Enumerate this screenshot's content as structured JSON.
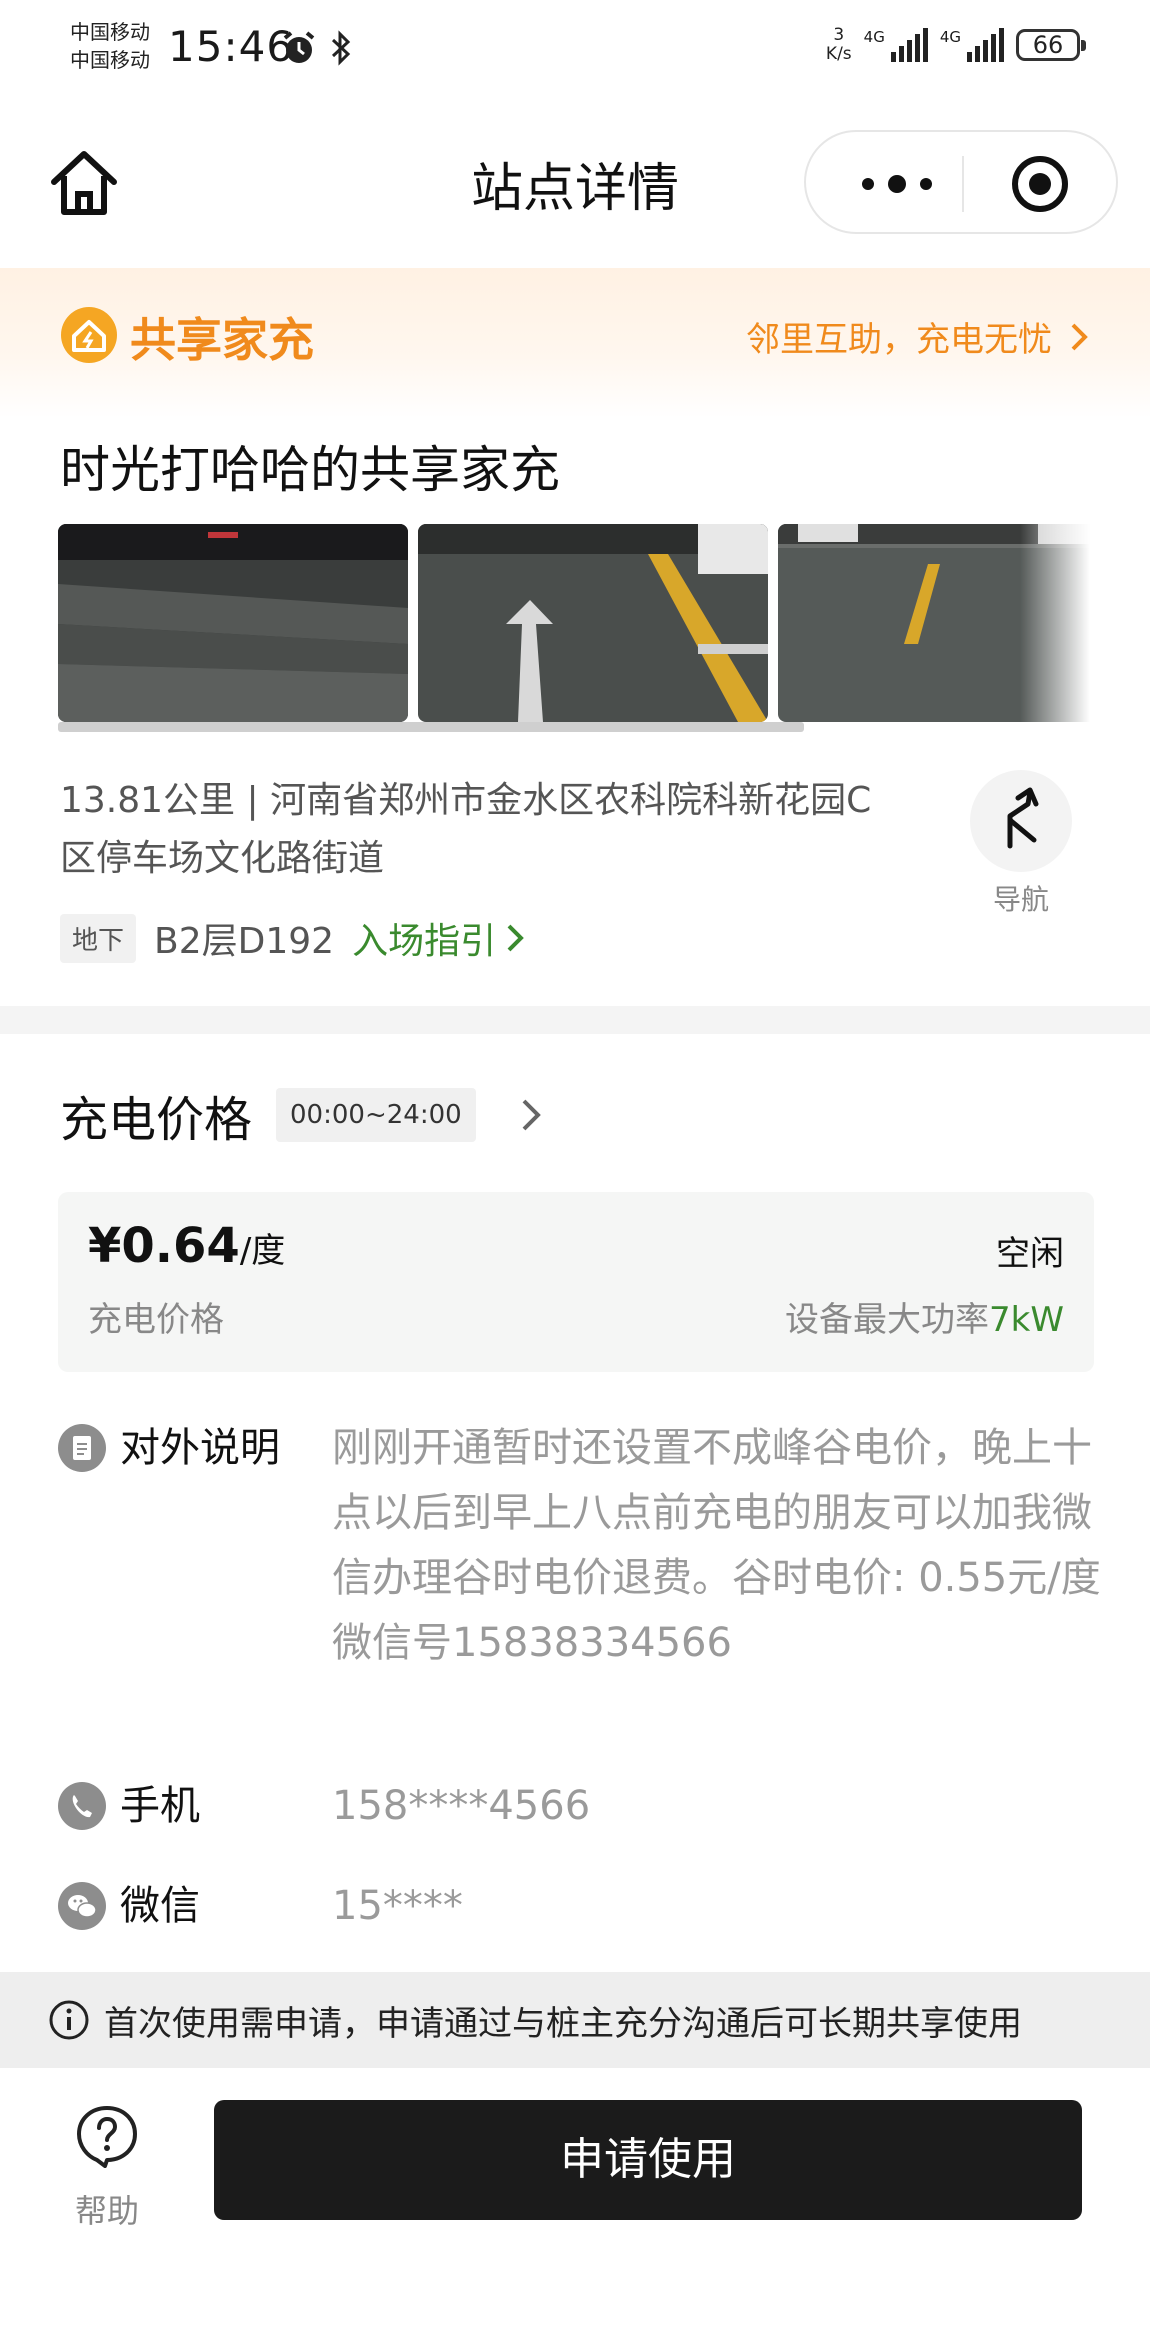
{
  "status_bar": {
    "carrier_1": "中国移动",
    "carrier_2": "中国移动",
    "time": "15:46",
    "net_speed_value": "3",
    "net_speed_unit": "K/s",
    "sim1_label": "4G",
    "sim2_label": "4G",
    "battery": "66"
  },
  "nav": {
    "title": "站点详情"
  },
  "banner": {
    "title": "共享家充",
    "slogan": "邻里互助，充电无忧"
  },
  "site": {
    "name": "时光打哈哈的共享家充",
    "address": "13.81公里 | 河南省郑州市金水区农科院科新花园C区停车场文化路街道",
    "navigate_label": "导航",
    "floor_tag": "地下",
    "floor": "B2层D192",
    "guide_link": "入场指引"
  },
  "price": {
    "section_title": "充电价格",
    "time_range": "00:00~24:00",
    "amount": "¥0.64",
    "unit": "/度",
    "label": "充电价格",
    "status": "空闲",
    "power_label": "设备最大功率",
    "power_value": "7kW"
  },
  "info": {
    "notice_label": "对外说明",
    "notice_text": "刚刚开通暂时还设置不成峰谷电价，晚上十点以后到早上八点前充电的朋友可以加我微信办理谷时电价退费。谷时电价: 0.55元/度",
    "notice_wechat": "微信号15838334566",
    "phone_label": "手机",
    "phone_value": "158****4566",
    "wechat_label": "微信",
    "wechat_value": "15****"
  },
  "notice_bar": {
    "text": "首次使用需申请，申请通过与桩主充分沟通后可长期共享使用"
  },
  "bottom": {
    "help_label": "帮助",
    "apply_button": "申请使用"
  },
  "colors": {
    "brand_orange": "#f08a1c",
    "accent_green": "#3a8a2e",
    "button_dark": "#1b1b1b"
  }
}
